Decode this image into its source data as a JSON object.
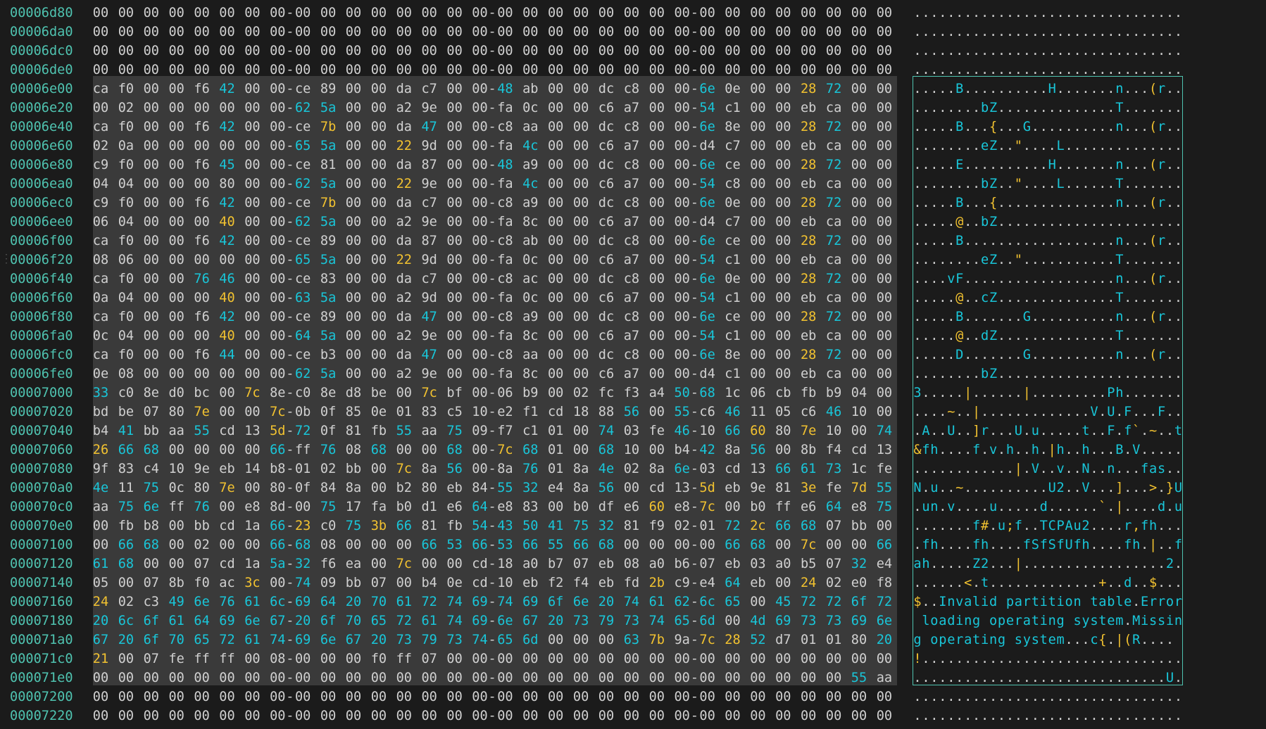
{
  "app": {
    "colors": {
      "background": "#1b1b1b",
      "selection": "#3a3a3a",
      "address": "#4fc3b0",
      "default": "#d0d0d0",
      "cyan": "#19c6d9",
      "yellow": "#f2c230"
    }
  },
  "hex_rows": [
    {
      "addr": "00006d80",
      "bytes": "00 00 00 00 00 00 00 00 00 00 00 00 00 00 00 00 00 00 00 00 00 00 00 00 00 00 00 00 00 00 00 00",
      "sel": false
    },
    {
      "addr": "00006da0",
      "bytes": "00 00 00 00 00 00 00 00 00 00 00 00 00 00 00 00 00 00 00 00 00 00 00 00 00 00 00 00 00 00 00 00",
      "sel": false
    },
    {
      "addr": "00006dc0",
      "bytes": "00 00 00 00 00 00 00 00 00 00 00 00 00 00 00 00 00 00 00 00 00 00 00 00 00 00 00 00 00 00 00 00",
      "sel": false
    },
    {
      "addr": "00006de0",
      "bytes": "00 00 00 00 00 00 00 00 00 00 00 00 00 00 00 00 00 00 00 00 00 00 00 00 00 00 00 00 00 00 00 00",
      "sel": false
    },
    {
      "addr": "00006e00",
      "bytes": "ca f0 00 00 f6 42 00 00 ce 89 00 00 da c7 00 00 48 ab 00 00 dc c8 00 00 6e 0e 00 00 28 72 00 00",
      "sel": true
    },
    {
      "addr": "00006e20",
      "bytes": "00 02 00 00 00 00 00 00 62 5a 00 00 a2 9e 00 00 fa 0c 00 00 c6 a7 00 00 54 c1 00 00 eb ca 00 00",
      "sel": true
    },
    {
      "addr": "00006e40",
      "bytes": "ca f0 00 00 f6 42 00 00 ce 7b 00 00 da 47 00 00 c8 aa 00 00 dc c8 00 00 6e 8e 00 00 28 72 00 00",
      "sel": true
    },
    {
      "addr": "00006e60",
      "bytes": "02 0a 00 00 00 00 00 00 65 5a 00 00 22 9d 00 00 fa 4c 00 00 c6 a7 00 00 d4 c7 00 00 eb ca 00 00",
      "sel": true
    },
    {
      "addr": "00006e80",
      "bytes": "c9 f0 00 00 f6 45 00 00 ce 81 00 00 da 87 00 00 48 a9 00 00 dc c8 00 00 6e ce 00 00 28 72 00 00",
      "sel": true
    },
    {
      "addr": "00006ea0",
      "bytes": "04 04 00 00 00 80 00 00 62 5a 00 00 22 9e 00 00 fa 4c 00 00 c6 a7 00 00 54 c8 00 00 eb ca 00 00",
      "sel": true
    },
    {
      "addr": "00006ec0",
      "bytes": "c9 f0 00 00 f6 42 00 00 ce 7b 00 00 da c7 00 00 c8 a9 00 00 dc c8 00 00 6e 0e 00 00 28 72 00 00",
      "sel": true
    },
    {
      "addr": "00006ee0",
      "bytes": "06 04 00 00 00 40 00 00 62 5a 00 00 a2 9e 00 00 fa 8c 00 00 c6 a7 00 00 d4 c7 00 00 eb ca 00 00",
      "sel": true
    },
    {
      "addr": "00006f00",
      "bytes": "ca f0 00 00 f6 42 00 00 ce 89 00 00 da 87 00 00 c8 ab 00 00 dc c8 00 00 6e ce 00 00 28 72 00 00",
      "sel": true
    },
    {
      "addr": "00006f20",
      "bytes": "08 06 00 00 00 00 00 00 65 5a 00 00 22 9d 00 00 fa 0c 00 00 c6 a7 00 00 54 c1 00 00 eb ca 00 00",
      "sel": true
    },
    {
      "addr": "00006f40",
      "bytes": "ca f0 00 00 76 46 00 00 ce 83 00 00 da c7 00 00 c8 ac 00 00 dc c8 00 00 6e 0e 00 00 28 72 00 00",
      "sel": true
    },
    {
      "addr": "00006f60",
      "bytes": "0a 04 00 00 00 40 00 00 63 5a 00 00 a2 9d 00 00 fa 0c 00 00 c6 a7 00 00 54 c1 00 00 eb ca 00 00",
      "sel": true
    },
    {
      "addr": "00006f80",
      "bytes": "ca f0 00 00 f6 42 00 00 ce 89 00 00 da 47 00 00 c8 a9 00 00 dc c8 00 00 6e ce 00 00 28 72 00 00",
      "sel": true
    },
    {
      "addr": "00006fa0",
      "bytes": "0c 04 00 00 00 40 00 00 64 5a 00 00 a2 9e 00 00 fa 8c 00 00 c6 a7 00 00 54 c1 00 00 eb ca 00 00",
      "sel": true
    },
    {
      "addr": "00006fc0",
      "bytes": "ca f0 00 00 f6 44 00 00 ce b3 00 00 da 47 00 00 c8 aa 00 00 dc c8 00 00 6e 8e 00 00 28 72 00 00",
      "sel": true
    },
    {
      "addr": "00006fe0",
      "bytes": "0e 08 00 00 00 00 00 00 62 5a 00 00 a2 9e 00 00 fa 8c 00 00 c6 a7 00 00 d4 c1 00 00 eb ca 00 00",
      "sel": true
    },
    {
      "addr": "00007000",
      "bytes": "33 c0 8e d0 bc 00 7c 8e c0 8e d8 be 00 7c bf 00 06 b9 00 02 fc f3 a4 50 68 1c 06 cb fb b9 04 00",
      "sel": true
    },
    {
      "addr": "00007020",
      "bytes": "bd be 07 80 7e 00 00 7c 0b 0f 85 0e 01 83 c5 10 e2 f1 cd 18 88 56 00 55 c6 46 11 05 c6 46 10 00",
      "sel": true
    },
    {
      "addr": "00007040",
      "bytes": "b4 41 bb aa 55 cd 13 5d 72 0f 81 fb 55 aa 75 09 f7 c1 01 00 74 03 fe 46 10 66 60 80 7e 10 00 74",
      "sel": true
    },
    {
      "addr": "00007060",
      "bytes": "26 66 68 00 00 00 00 66 ff 76 08 68 00 00 68 00 7c 68 01 00 68 10 00 b4 42 8a 56 00 8b f4 cd 13",
      "sel": true
    },
    {
      "addr": "00007080",
      "bytes": "9f 83 c4 10 9e eb 14 b8 01 02 bb 00 7c 8a 56 00 8a 76 01 8a 4e 02 8a 6e 03 cd 13 66 61 73 1c fe",
      "sel": true
    },
    {
      "addr": "000070a0",
      "bytes": "4e 11 75 0c 80 7e 00 80 0f 84 8a 00 b2 80 eb 84 55 32 e4 8a 56 00 cd 13 5d eb 9e 81 3e fe 7d 55",
      "sel": true
    },
    {
      "addr": "000070c0",
      "bytes": "aa 75 6e ff 76 00 e8 8d 00 75 17 fa b0 d1 e6 64 e8 83 00 b0 df e6 60 e8 7c 00 b0 ff e6 64 e8 75",
      "sel": true
    },
    {
      "addr": "000070e0",
      "bytes": "00 fb b8 00 bb cd 1a 66 23 c0 75 3b 66 81 fb 54 43 50 41 75 32 81 f9 02 01 72 2c 66 68 07 bb 00",
      "sel": true
    },
    {
      "addr": "00007100",
      "bytes": "00 66 68 00 02 00 00 66 68 08 00 00 00 66 53 66 53 66 55 66 68 00 00 00 00 66 68 00 7c 00 00 66",
      "sel": true
    },
    {
      "addr": "00007120",
      "bytes": "61 68 00 00 07 cd 1a 5a 32 f6 ea 00 7c 00 00 cd 18 a0 b7 07 eb 08 a0 b6 07 eb 03 a0 b5 07 32 e4",
      "sel": true
    },
    {
      "addr": "00007140",
      "bytes": "05 00 07 8b f0 ac 3c 00 74 09 bb 07 00 b4 0e cd 10 eb f2 f4 eb fd 2b c9 e4 64 eb 00 24 02 e0 f8",
      "sel": true
    },
    {
      "addr": "00007160",
      "bytes": "24 02 c3 49 6e 76 61 6c 69 64 20 70 61 72 74 69 74 69 6f 6e 20 74 61 62 6c 65 00 45 72 72 6f 72",
      "sel": true
    },
    {
      "addr": "00007180",
      "bytes": "20 6c 6f 61 64 69 6e 67 20 6f 70 65 72 61 74 69 6e 67 20 73 79 73 74 65 6d 00 4d 69 73 73 69 6e",
      "sel": true
    },
    {
      "addr": "000071a0",
      "bytes": "67 20 6f 70 65 72 61 74 69 6e 67 20 73 79 73 74 65 6d 00 00 00 63 7b 9a 7c 28 52 d7 01 01 80 20",
      "sel": true
    },
    {
      "addr": "000071c0",
      "bytes": "21 00 07 fe ff ff 00 08 00 00 00 f0 ff 07 00 00 00 00 00 00 00 00 00 00 00 00 00 00 00 00 00 00",
      "sel": true
    },
    {
      "addr": "000071e0",
      "bytes": "00 00 00 00 00 00 00 00 00 00 00 00 00 00 00 00 00 00 00 00 00 00 00 00 00 00 00 00 00 00 55 aa",
      "sel": true
    },
    {
      "addr": "00007200",
      "bytes": "00 00 00 00 00 00 00 00 00 00 00 00 00 00 00 00 00 00 00 00 00 00 00 00 00 00 00 00 00 00 00 00",
      "sel": false
    },
    {
      "addr": "00007220",
      "bytes": "00 00 00 00 00 00 00 00 00 00 00 00 00 00 00 00 00 00 00 00 00 00 00 00 00 00 00 00 00 00 00 00",
      "sel": false
    }
  ]
}
